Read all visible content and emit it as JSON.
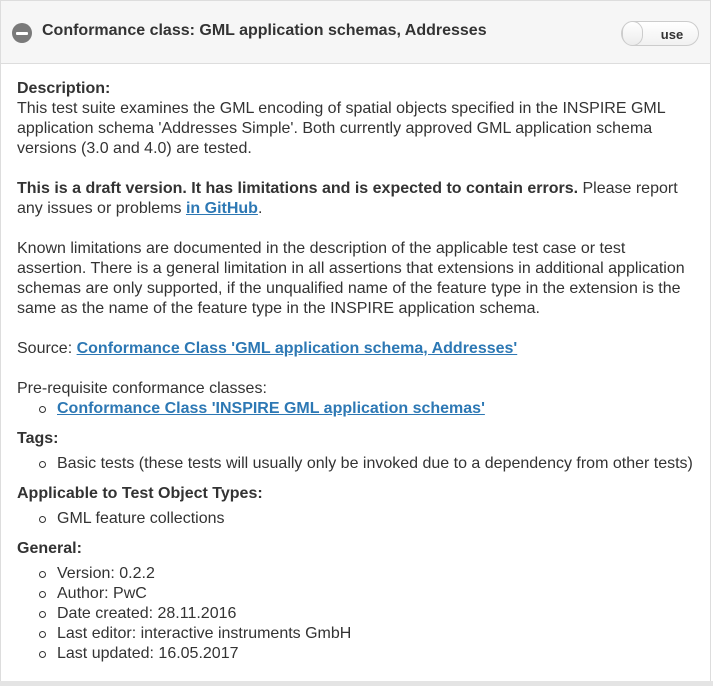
{
  "header": {
    "title": "Conformance class: GML application schemas, Addresses",
    "toggle_label": "use",
    "collapse_icon": "minus-circle-icon"
  },
  "description": {
    "heading": "Description:",
    "para1": "This test suite examines the GML encoding of spatial objects specified in the INSPIRE GML application schema 'Addresses Simple'. Both currently approved GML application schema versions (3.0 and 4.0) are tested.",
    "draft_bold": "This is a draft version. It has limitations and is expected to contain errors.",
    "draft_rest": " Please report any issues or problems ",
    "github_link": "in GitHub",
    "github_after": ".",
    "para3": "Known limitations are documented in the description of the applicable test case or test assertion. There is a general limitation in all assertions that extensions in additional application schemas are only supported, if the unqualified name of the feature type in the extension is the same as the name of the feature type in the INSPIRE application schema.",
    "source_label": "Source: ",
    "source_link": "Conformance Class 'GML application schema, Addresses'",
    "prereq_label": "Pre-requisite conformance classes:",
    "prereq_items": [
      "Conformance Class 'INSPIRE GML application schemas'"
    ]
  },
  "tags": {
    "heading": "Tags:",
    "items": [
      "Basic tests (these tests will usually only be invoked due to a dependency from other tests)"
    ]
  },
  "applicable": {
    "heading": "Applicable to Test Object Types:",
    "items": [
      "GML feature collections"
    ]
  },
  "general": {
    "heading": "General:",
    "items": [
      "Version: 0.2.2",
      "Author: PwC",
      "Date created: 28.11.2016",
      "Last editor: interactive instruments GmbH",
      "Last updated: 16.05.2017"
    ]
  },
  "colors": {
    "link": "#2d78b4",
    "header_bg": "#f6f6f6",
    "text": "#333333"
  }
}
